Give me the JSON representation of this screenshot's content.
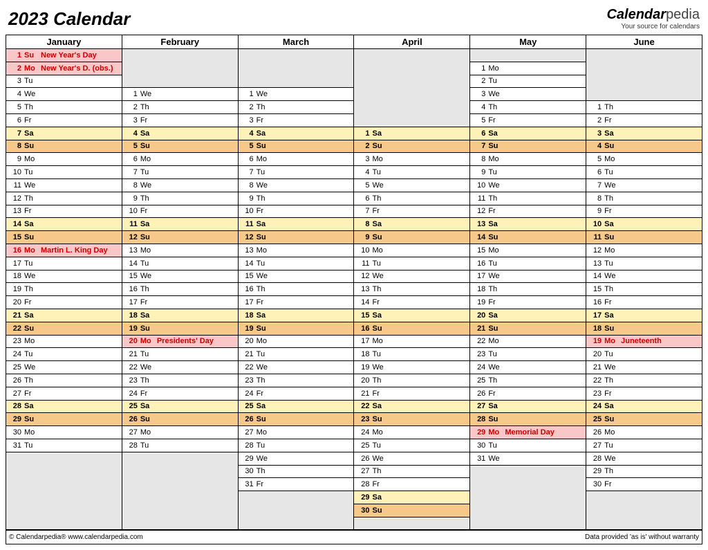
{
  "title": "2023 Calendar",
  "brand": {
    "name1": "Calendar",
    "name2": "pedia",
    "tagline": "Your source for calendars"
  },
  "footer": {
    "left": "© Calendarpedia®   www.calendarpedia.com",
    "right": "Data provided 'as is' without warranty"
  },
  "months": [
    {
      "name": "January",
      "startRow": 0,
      "endRow": 30,
      "days": [
        {
          "n": 1,
          "d": "Su",
          "k": "hol",
          "e": "New Year's Day"
        },
        {
          "n": 2,
          "d": "Mo",
          "k": "hol",
          "e": "New Year's D. (obs.)"
        },
        {
          "n": 3,
          "d": "Tu"
        },
        {
          "n": 4,
          "d": "We"
        },
        {
          "n": 5,
          "d": "Th"
        },
        {
          "n": 6,
          "d": "Fr"
        },
        {
          "n": 7,
          "d": "Sa",
          "k": "sat"
        },
        {
          "n": 8,
          "d": "Su",
          "k": "sun"
        },
        {
          "n": 9,
          "d": "Mo"
        },
        {
          "n": 10,
          "d": "Tu"
        },
        {
          "n": 11,
          "d": "We"
        },
        {
          "n": 12,
          "d": "Th"
        },
        {
          "n": 13,
          "d": "Fr"
        },
        {
          "n": 14,
          "d": "Sa",
          "k": "sat"
        },
        {
          "n": 15,
          "d": "Su",
          "k": "sun"
        },
        {
          "n": 16,
          "d": "Mo",
          "k": "hol",
          "e": "Martin L. King Day"
        },
        {
          "n": 17,
          "d": "Tu"
        },
        {
          "n": 18,
          "d": "We"
        },
        {
          "n": 19,
          "d": "Th"
        },
        {
          "n": 20,
          "d": "Fr"
        },
        {
          "n": 21,
          "d": "Sa",
          "k": "sat"
        },
        {
          "n": 22,
          "d": "Su",
          "k": "sun"
        },
        {
          "n": 23,
          "d": "Mo"
        },
        {
          "n": 24,
          "d": "Tu"
        },
        {
          "n": 25,
          "d": "We"
        },
        {
          "n": 26,
          "d": "Th"
        },
        {
          "n": 27,
          "d": "Fr"
        },
        {
          "n": 28,
          "d": "Sa",
          "k": "sat"
        },
        {
          "n": 29,
          "d": "Su",
          "k": "sun"
        },
        {
          "n": 30,
          "d": "Mo"
        },
        {
          "n": 31,
          "d": "Tu"
        }
      ]
    },
    {
      "name": "February",
      "startRow": 3,
      "endRow": 30,
      "days": [
        {
          "n": 1,
          "d": "We"
        },
        {
          "n": 2,
          "d": "Th"
        },
        {
          "n": 3,
          "d": "Fr"
        },
        {
          "n": 4,
          "d": "Sa",
          "k": "sat"
        },
        {
          "n": 5,
          "d": "Su",
          "k": "sun"
        },
        {
          "n": 6,
          "d": "Mo"
        },
        {
          "n": 7,
          "d": "Tu"
        },
        {
          "n": 8,
          "d": "We"
        },
        {
          "n": 9,
          "d": "Th"
        },
        {
          "n": 10,
          "d": "Fr"
        },
        {
          "n": 11,
          "d": "Sa",
          "k": "sat"
        },
        {
          "n": 12,
          "d": "Su",
          "k": "sun"
        },
        {
          "n": 13,
          "d": "Mo"
        },
        {
          "n": 14,
          "d": "Tu"
        },
        {
          "n": 15,
          "d": "We"
        },
        {
          "n": 16,
          "d": "Th"
        },
        {
          "n": 17,
          "d": "Fr"
        },
        {
          "n": 18,
          "d": "Sa",
          "k": "sat"
        },
        {
          "n": 19,
          "d": "Su",
          "k": "sun"
        },
        {
          "n": 20,
          "d": "Mo",
          "k": "hol",
          "e": "Presidents' Day"
        },
        {
          "n": 21,
          "d": "Tu"
        },
        {
          "n": 22,
          "d": "We"
        },
        {
          "n": 23,
          "d": "Th"
        },
        {
          "n": 24,
          "d": "Fr"
        },
        {
          "n": 25,
          "d": "Sa",
          "k": "sat"
        },
        {
          "n": 26,
          "d": "Su",
          "k": "sun"
        },
        {
          "n": 27,
          "d": "Mo"
        },
        {
          "n": 28,
          "d": "Tu"
        }
      ]
    },
    {
      "name": "March",
      "startRow": 3,
      "endRow": 33,
      "days": [
        {
          "n": 1,
          "d": "We"
        },
        {
          "n": 2,
          "d": "Th"
        },
        {
          "n": 3,
          "d": "Fr"
        },
        {
          "n": 4,
          "d": "Sa",
          "k": "sat"
        },
        {
          "n": 5,
          "d": "Su",
          "k": "sun"
        },
        {
          "n": 6,
          "d": "Mo"
        },
        {
          "n": 7,
          "d": "Tu"
        },
        {
          "n": 8,
          "d": "We"
        },
        {
          "n": 9,
          "d": "Th"
        },
        {
          "n": 10,
          "d": "Fr"
        },
        {
          "n": 11,
          "d": "Sa",
          "k": "sat"
        },
        {
          "n": 12,
          "d": "Su",
          "k": "sun"
        },
        {
          "n": 13,
          "d": "Mo"
        },
        {
          "n": 14,
          "d": "Tu"
        },
        {
          "n": 15,
          "d": "We"
        },
        {
          "n": 16,
          "d": "Th"
        },
        {
          "n": 17,
          "d": "Fr"
        },
        {
          "n": 18,
          "d": "Sa",
          "k": "sat"
        },
        {
          "n": 19,
          "d": "Su",
          "k": "sun"
        },
        {
          "n": 20,
          "d": "Mo"
        },
        {
          "n": 21,
          "d": "Tu"
        },
        {
          "n": 22,
          "d": "We"
        },
        {
          "n": 23,
          "d": "Th"
        },
        {
          "n": 24,
          "d": "Fr"
        },
        {
          "n": 25,
          "d": "Sa",
          "k": "sat"
        },
        {
          "n": 26,
          "d": "Su",
          "k": "sun"
        },
        {
          "n": 27,
          "d": "Mo"
        },
        {
          "n": 28,
          "d": "Tu"
        },
        {
          "n": 29,
          "d": "We"
        },
        {
          "n": 30,
          "d": "Th"
        },
        {
          "n": 31,
          "d": "Fr"
        }
      ]
    },
    {
      "name": "April",
      "startRow": 6,
      "endRow": 35,
      "days": [
        {
          "n": 1,
          "d": "Sa",
          "k": "sat"
        },
        {
          "n": 2,
          "d": "Su",
          "k": "sun"
        },
        {
          "n": 3,
          "d": "Mo"
        },
        {
          "n": 4,
          "d": "Tu"
        },
        {
          "n": 5,
          "d": "We"
        },
        {
          "n": 6,
          "d": "Th"
        },
        {
          "n": 7,
          "d": "Fr"
        },
        {
          "n": 8,
          "d": "Sa",
          "k": "sat"
        },
        {
          "n": 9,
          "d": "Su",
          "k": "sun"
        },
        {
          "n": 10,
          "d": "Mo"
        },
        {
          "n": 11,
          "d": "Tu"
        },
        {
          "n": 12,
          "d": "We"
        },
        {
          "n": 13,
          "d": "Th"
        },
        {
          "n": 14,
          "d": "Fr"
        },
        {
          "n": 15,
          "d": "Sa",
          "k": "sat"
        },
        {
          "n": 16,
          "d": "Su",
          "k": "sun"
        },
        {
          "n": 17,
          "d": "Mo"
        },
        {
          "n": 18,
          "d": "Tu"
        },
        {
          "n": 19,
          "d": "We"
        },
        {
          "n": 20,
          "d": "Th"
        },
        {
          "n": 21,
          "d": "Fr"
        },
        {
          "n": 22,
          "d": "Sa",
          "k": "sat"
        },
        {
          "n": 23,
          "d": "Su",
          "k": "sun"
        },
        {
          "n": 24,
          "d": "Mo"
        },
        {
          "n": 25,
          "d": "Tu"
        },
        {
          "n": 26,
          "d": "We"
        },
        {
          "n": 27,
          "d": "Th"
        },
        {
          "n": 28,
          "d": "Fr"
        },
        {
          "n": 29,
          "d": "Sa",
          "k": "sat"
        },
        {
          "n": 30,
          "d": "Su",
          "k": "sun"
        }
      ]
    },
    {
      "name": "May",
      "startRow": 1,
      "endRow": 31,
      "days": [
        {
          "n": 1,
          "d": "Mo"
        },
        {
          "n": 2,
          "d": "Tu"
        },
        {
          "n": 3,
          "d": "We"
        },
        {
          "n": 4,
          "d": "Th"
        },
        {
          "n": 5,
          "d": "Fr"
        },
        {
          "n": 6,
          "d": "Sa",
          "k": "sat"
        },
        {
          "n": 7,
          "d": "Su",
          "k": "sun"
        },
        {
          "n": 8,
          "d": "Mo"
        },
        {
          "n": 9,
          "d": "Tu"
        },
        {
          "n": 10,
          "d": "We"
        },
        {
          "n": 11,
          "d": "Th"
        },
        {
          "n": 12,
          "d": "Fr"
        },
        {
          "n": 13,
          "d": "Sa",
          "k": "sat"
        },
        {
          "n": 14,
          "d": "Su",
          "k": "sun"
        },
        {
          "n": 15,
          "d": "Mo"
        },
        {
          "n": 16,
          "d": "Tu"
        },
        {
          "n": 17,
          "d": "We"
        },
        {
          "n": 18,
          "d": "Th"
        },
        {
          "n": 19,
          "d": "Fr"
        },
        {
          "n": 20,
          "d": "Sa",
          "k": "sat"
        },
        {
          "n": 21,
          "d": "Su",
          "k": "sun"
        },
        {
          "n": 22,
          "d": "Mo"
        },
        {
          "n": 23,
          "d": "Tu"
        },
        {
          "n": 24,
          "d": "We"
        },
        {
          "n": 25,
          "d": "Th"
        },
        {
          "n": 26,
          "d": "Fr"
        },
        {
          "n": 27,
          "d": "Sa",
          "k": "sat"
        },
        {
          "n": 28,
          "d": "Su",
          "k": "sun"
        },
        {
          "n": 29,
          "d": "Mo",
          "k": "hol",
          "e": "Memorial Day"
        },
        {
          "n": 30,
          "d": "Tu"
        },
        {
          "n": 31,
          "d": "We"
        }
      ]
    },
    {
      "name": "June",
      "startRow": 4,
      "endRow": 33,
      "days": [
        {
          "n": 1,
          "d": "Th"
        },
        {
          "n": 2,
          "d": "Fr"
        },
        {
          "n": 3,
          "d": "Sa",
          "k": "sat"
        },
        {
          "n": 4,
          "d": "Su",
          "k": "sun"
        },
        {
          "n": 5,
          "d": "Mo"
        },
        {
          "n": 6,
          "d": "Tu"
        },
        {
          "n": 7,
          "d": "We"
        },
        {
          "n": 8,
          "d": "Th"
        },
        {
          "n": 9,
          "d": "Fr"
        },
        {
          "n": 10,
          "d": "Sa",
          "k": "sat"
        },
        {
          "n": 11,
          "d": "Su",
          "k": "sun"
        },
        {
          "n": 12,
          "d": "Mo"
        },
        {
          "n": 13,
          "d": "Tu"
        },
        {
          "n": 14,
          "d": "We"
        },
        {
          "n": 15,
          "d": "Th"
        },
        {
          "n": 16,
          "d": "Fr"
        },
        {
          "n": 17,
          "d": "Sa",
          "k": "sat"
        },
        {
          "n": 18,
          "d": "Su",
          "k": "sun"
        },
        {
          "n": 19,
          "d": "Mo",
          "k": "hol",
          "e": "Juneteenth"
        },
        {
          "n": 20,
          "d": "Tu"
        },
        {
          "n": 21,
          "d": "We"
        },
        {
          "n": 22,
          "d": "Th"
        },
        {
          "n": 23,
          "d": "Fr"
        },
        {
          "n": 24,
          "d": "Sa",
          "k": "sat"
        },
        {
          "n": 25,
          "d": "Su",
          "k": "sun"
        },
        {
          "n": 26,
          "d": "Mo"
        },
        {
          "n": 27,
          "d": "Tu"
        },
        {
          "n": 28,
          "d": "We"
        },
        {
          "n": 29,
          "d": "Th"
        },
        {
          "n": 30,
          "d": "Fr"
        }
      ]
    }
  ],
  "totalRows": 37
}
